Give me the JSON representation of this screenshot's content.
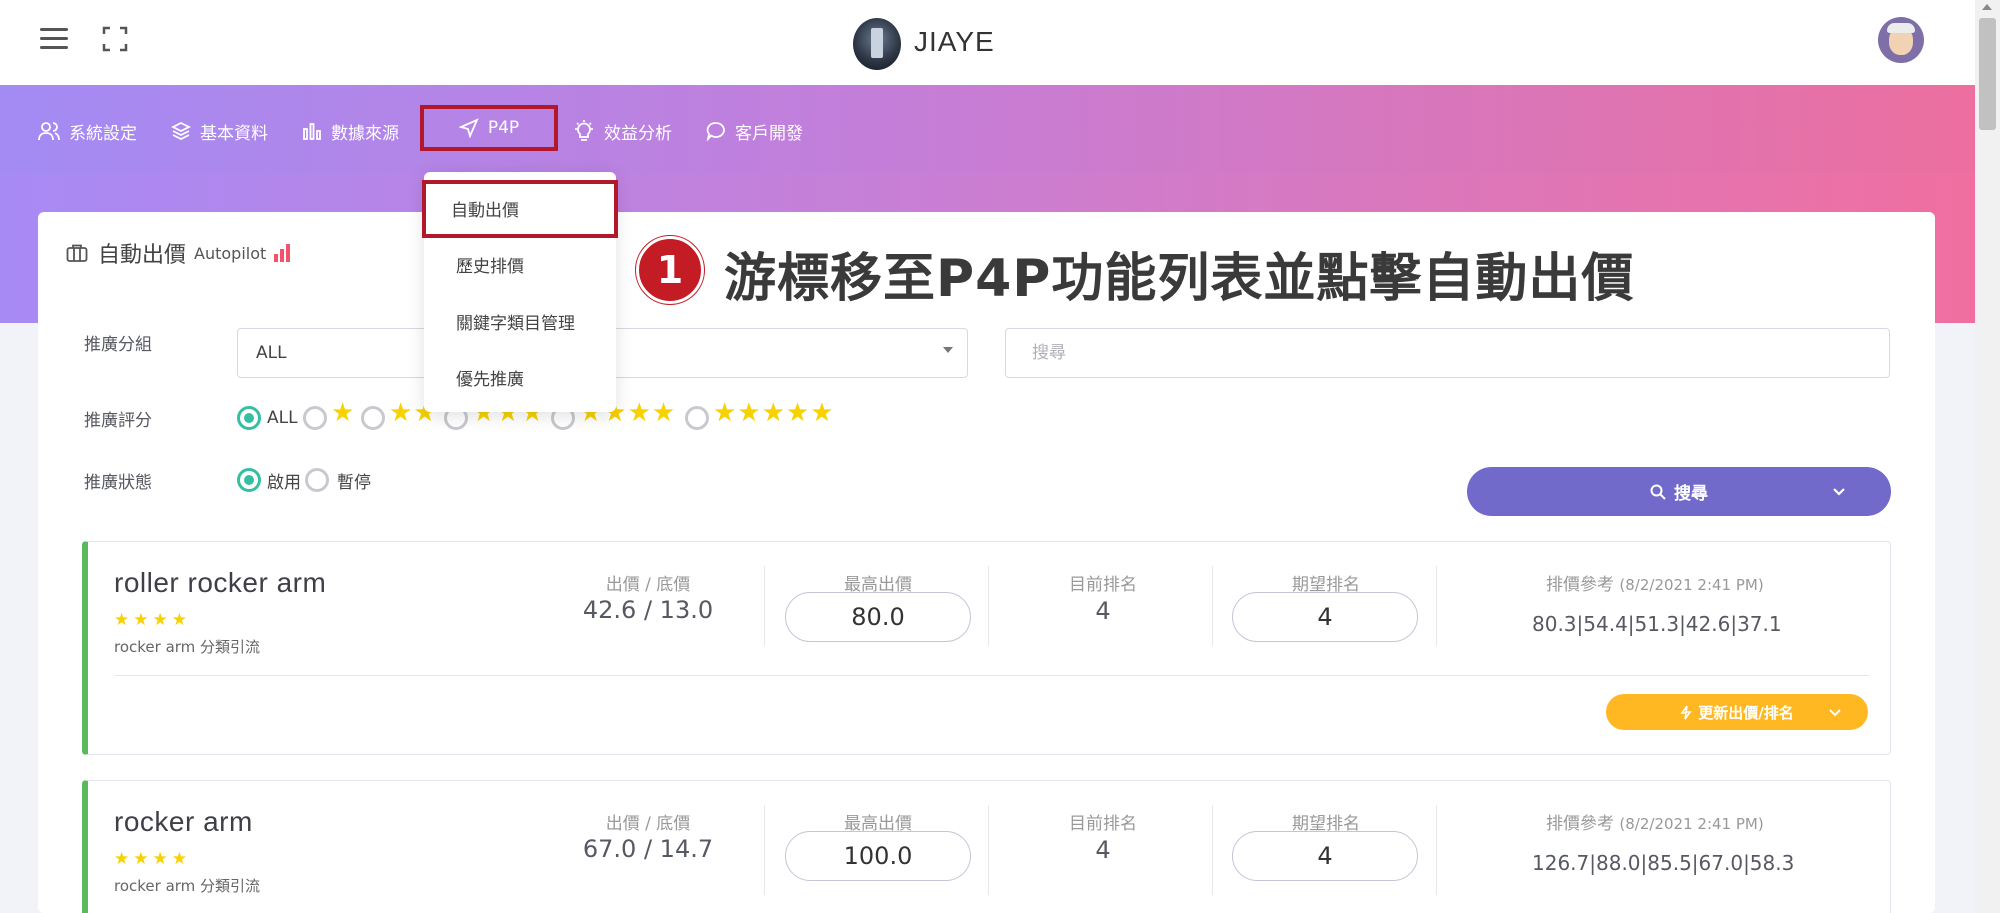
{
  "header": {
    "brand": "JIAYE"
  },
  "menu": {
    "items": [
      {
        "label": "系統設定",
        "icon": "users-icon"
      },
      {
        "label": "基本資料",
        "icon": "layers-icon"
      },
      {
        "label": "數據來源",
        "icon": "bar-chart-icon"
      },
      {
        "label": "P4P",
        "icon": "navigation-icon"
      },
      {
        "label": "效益分析",
        "icon": "lightbulb-icon"
      },
      {
        "label": "客戶開發",
        "icon": "chat-icon"
      }
    ],
    "dropdown": [
      "自動出價",
      "歷史排價",
      "關鍵字類目管理",
      "優先推廣"
    ]
  },
  "annotation": {
    "number": "1",
    "text": "游標移至P4P功能列表並點擊自動出價"
  },
  "page": {
    "title": "自動出價",
    "subtitle": "Autopilot"
  },
  "filters": {
    "group_label": "推廣分組",
    "group_value": "ALL",
    "search_placeholder": "搜尋",
    "rating_label": "推廣評分",
    "rating_all": "ALL",
    "rating_options": [
      "★",
      "★★",
      "★★★",
      "★★★★",
      "★★★★★"
    ],
    "status_label": "推廣狀態",
    "status_on": "啟用",
    "status_off": "暫停",
    "search_button": "搜尋"
  },
  "columns": {
    "bid_floor": "出價 / 底價",
    "max_bid": "最高出價",
    "current_rank": "目前排名",
    "expected_rank": "期望排名",
    "ref_label": "排價參考"
  },
  "rows": [
    {
      "name": "roller rocker arm",
      "stars": "★★★★",
      "group": "rocker arm 分類引流",
      "bid_floor": "42.6 / 13.0",
      "max_bid": "80.0",
      "current_rank": "4",
      "expected_rank": "4",
      "ref_time": "(8/2/2021 2:41 PM)",
      "ref_values": "80.3|54.4|51.3|42.6|37.1",
      "update_label": "更新出價/排名"
    },
    {
      "name": "rocker arm",
      "stars": "★★★★",
      "group": "rocker arm 分類引流",
      "bid_floor": "67.0 / 14.7",
      "max_bid": "100.0",
      "current_rank": "4",
      "expected_rank": "4",
      "ref_time": "(8/2/2021 2:41 PM)",
      "ref_values": "126.7|88.0|85.5|67.0|58.3"
    }
  ],
  "colors": {
    "gradient_start": "#a88af5",
    "gradient_end": "#f06fa0",
    "highlight_border": "#b2182b",
    "search_button": "#716aca",
    "update_button": "#ffb822",
    "row_accent": "#5cb85c",
    "radio_on": "#34bfa3"
  }
}
